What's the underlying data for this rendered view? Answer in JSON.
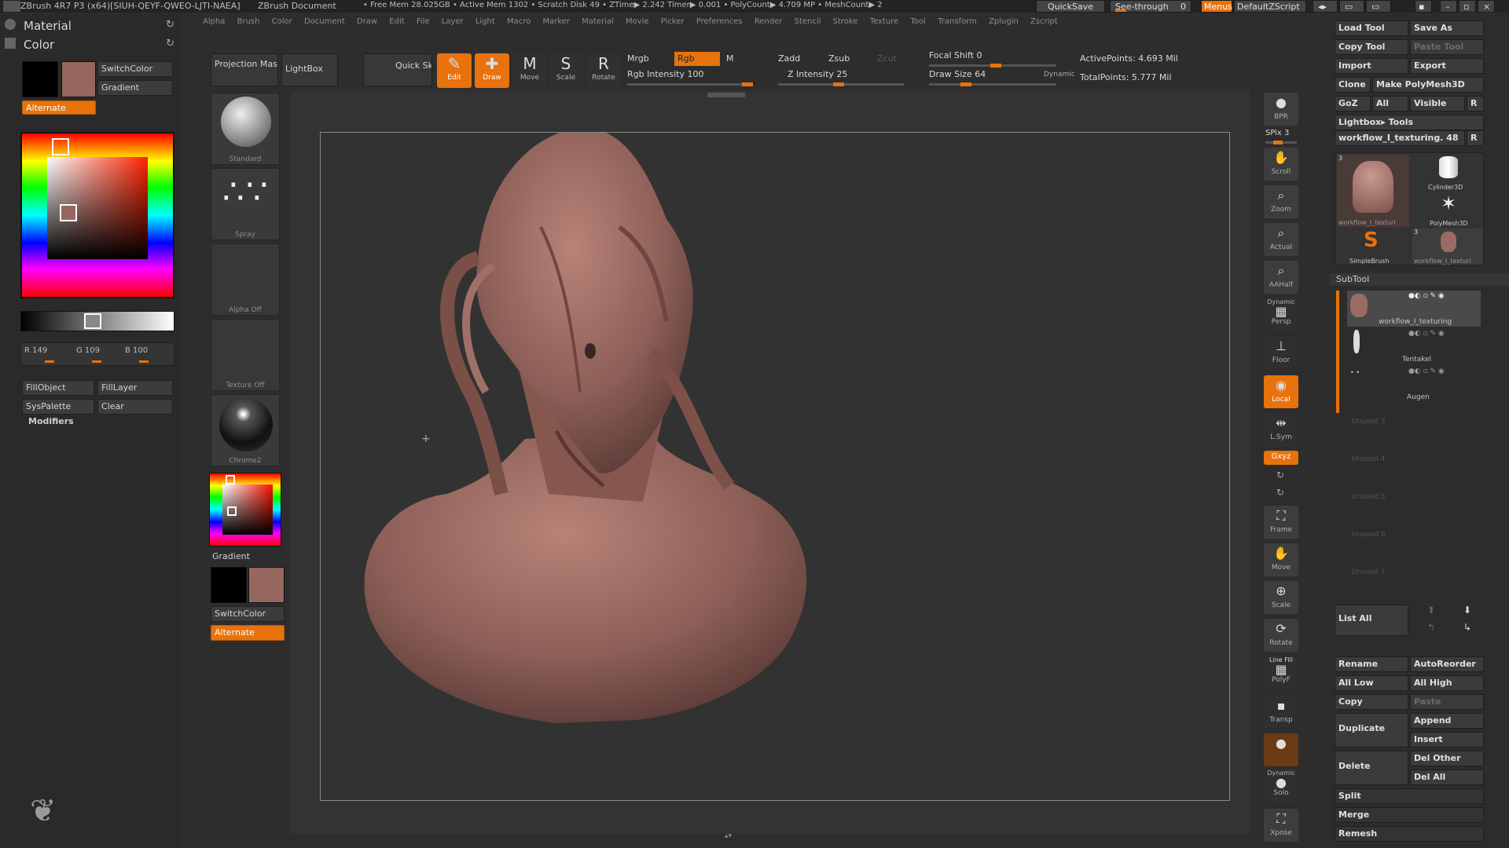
{
  "titlebar": {
    "app": "ZBrush 4R7 P3 (x64)[SIUH-QEYF-QWEO-LJTI-NAEA]",
    "doc": "ZBrush Document",
    "stats": "• Free Mem 28.025GB • Active Mem 1302 • Scratch Disk 49 • ZTime▶ 2.242 Timer▶ 0.001 • PolyCount▶ 4.709 MP • MeshCount▶ 2",
    "quicksave": "QuickSave",
    "seethrough": "See-through",
    "seethrough_val": "0",
    "menus": "Menus",
    "script": "DefaultZScript"
  },
  "menu": [
    "Alpha",
    "Brush",
    "Color",
    "Document",
    "Draw",
    "Edit",
    "File",
    "Layer",
    "Light",
    "Macro",
    "Marker",
    "Material",
    "Movie",
    "Picker",
    "Preferences",
    "Render",
    "Stencil",
    "Stroke",
    "Texture",
    "Tool",
    "Transform",
    "Zplugin",
    "Zscript"
  ],
  "left": {
    "material": "Material",
    "color": "Color",
    "switchcolor": "SwitchColor",
    "gradient": "Gradient",
    "alternate": "Alternate",
    "r": "R 149",
    "g": "G 109",
    "b": "B 100",
    "fillobject": "FillObject",
    "filllayer": "FillLayer",
    "syspalette": "SysPalette",
    "clear": "Clear",
    "modifiers": "Modifiers",
    "main_color": "#95675f"
  },
  "shelf": {
    "projection": "Projection Master",
    "lightbox": "LightBox",
    "quicksketch": "Quick Sketch",
    "edit": "Edit",
    "draw": "Draw",
    "move": "Move",
    "scale": "Scale",
    "rotate": "Rotate",
    "mrgb": "Mrgb",
    "rgb": "Rgb",
    "m": "M",
    "rgb_intensity": "Rgb Intensity 100",
    "zadd": "Zadd",
    "zsub": "Zsub",
    "zcut": "Zcut",
    "z_intensity": "Z Intensity 25",
    "focal_shift": "Focal Shift 0",
    "draw_size": "Draw Size 64",
    "dynamic": "Dynamic",
    "active_points": "ActivePoints: 4.693 Mil",
    "total_points": "TotalPoints: 5.777 Mil"
  },
  "tray": {
    "standard": "Standard",
    "spray": "Spray",
    "alpha_off": "Alpha  Off",
    "texture_off": "Texture  Off",
    "chrome": "Chrome2",
    "gradient": "Gradient",
    "switchcolor": "SwitchColor",
    "alternate": "Alternate"
  },
  "rshelf": {
    "bpr": "BPR",
    "spix": "SPix 3",
    "scroll": "Scroll",
    "zoom": "Zoom",
    "actual": "Actual",
    "aahalf": "AAHalf",
    "dynamic": "Dynamic",
    "persp": "Persp",
    "floor": "Floor",
    "local": "Local",
    "lsym": "L.Sym",
    "xyz": "Gxyz",
    "frame": "Frame",
    "move": "Move",
    "scale": "Scale",
    "rotate": "Rotate",
    "linefill": "Line Fill",
    "polyf": "PolyF",
    "transp": "Transp",
    "dynamic2": "Dynamic",
    "solo": "Solo",
    "xpose": "Xpose"
  },
  "right": {
    "load_tool": "Load Tool",
    "save_as": "Save As",
    "copy_tool": "Copy Tool",
    "paste_tool": "Paste Tool",
    "import": "Import",
    "export": "Export",
    "clone": "Clone",
    "make_polymesh": "Make PolyMesh3D",
    "goz": "GoZ",
    "all": "All",
    "visible": "Visible",
    "r": "R",
    "lightbox_tools": "Lightbox▸ Tools",
    "current_tool": "workflow_I_texturing. 48",
    "thumbs": [
      "workflow_I_texturi",
      "Cylinder3D",
      "PolyMesh3D",
      "SimpleBrush",
      "workflow_I_texturi"
    ],
    "thumb_counts": [
      "3",
      "3"
    ],
    "subtool": "SubTool",
    "subtools": [
      "workflow_I_texturing",
      "Tentakel",
      "Augen"
    ],
    "unused": [
      "Unused 3",
      "Unused 4",
      "Unused 5",
      "Unused 6",
      "Unused 7"
    ],
    "list_all": "List All",
    "rename": "Rename",
    "autoreorder": "AutoReorder",
    "all_low": "All Low",
    "all_high": "All High",
    "copy": "Copy",
    "paste": "Paste",
    "duplicate": "Duplicate",
    "append": "Append",
    "insert": "Insert",
    "delete": "Delete",
    "del_other": "Del Other",
    "del_all": "Del All",
    "split": "Split",
    "merge": "Merge",
    "remesh": "Remesh"
  },
  "colors": {
    "accent": "#e8720c",
    "skin": "#9a6b63"
  }
}
